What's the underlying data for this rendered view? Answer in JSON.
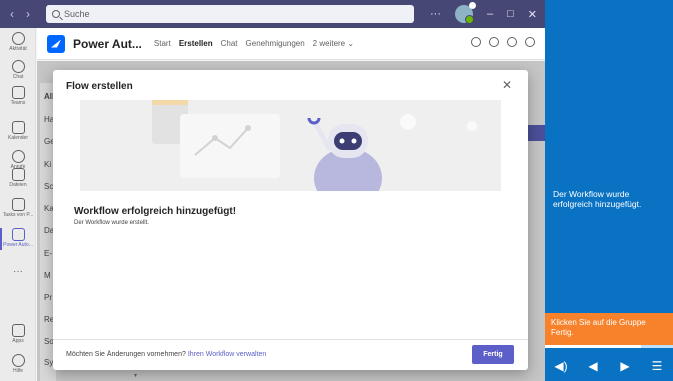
{
  "titlebar": {
    "search_placeholder": "Suche",
    "more": "···",
    "minimize": "–",
    "maximize": "□",
    "close": "✕"
  },
  "rail": {
    "items": [
      {
        "label": "Aktivität",
        "icon": "bell-icon"
      },
      {
        "label": "Chat",
        "icon": "chat-icon"
      },
      {
        "label": "Teams",
        "icon": "teams-icon"
      },
      {
        "label": "Kalender",
        "icon": "calendar-icon"
      },
      {
        "label": "Anrufe",
        "icon": "phone-icon"
      },
      {
        "label": "Dateien",
        "icon": "file-icon"
      },
      {
        "label": "Tasks von P...",
        "icon": "tasks-icon"
      },
      {
        "label": "Power Auto...",
        "icon": "power-automate-icon"
      },
      {
        "label": "Apps",
        "icon": "apps-icon"
      },
      {
        "label": "Hilfe",
        "icon": "help-icon"
      }
    ],
    "more": "···"
  },
  "app_header": {
    "app_name": "Power Aut...",
    "tabs": [
      "Start",
      "Erstellen",
      "Chat",
      "Genehmigungen",
      "2 weitere ⌄"
    ],
    "active_tab": "Erstellen"
  },
  "background_list": [
    "All",
    "Ha",
    "Ge",
    "Ki",
    "Sc",
    "Ka",
    "Da",
    "E-",
    "M",
    "Pr",
    "Re",
    "So",
    "Sy"
  ],
  "modal": {
    "title": "Flow erstellen",
    "close": "✕",
    "success_title": "Workflow erfolgreich hinzugefügt!",
    "success_subtitle": "Der Workflow wurde erstellt.",
    "footer_text": "Möchten Sie Änderungen vornehmen?",
    "footer_link": "Ihren Workflow verwalten",
    "done_button": "Fertig"
  },
  "scroll_hint": "▾",
  "tutorial": {
    "message": "Der Workflow wurde erfolgreich hinzugefügt.",
    "hint": "Klicken Sie auf die Gruppe Fertig.",
    "progress": 0.75,
    "controls": {
      "volume": "◀)",
      "back": "◀",
      "forward": "▶",
      "menu": "☰"
    }
  },
  "colors": {
    "teams_titlebar": "#464775",
    "teams_accent": "#5b5fc7",
    "tutorial_blue": "#0a72c2",
    "tutorial_orange": "#f7822b"
  }
}
